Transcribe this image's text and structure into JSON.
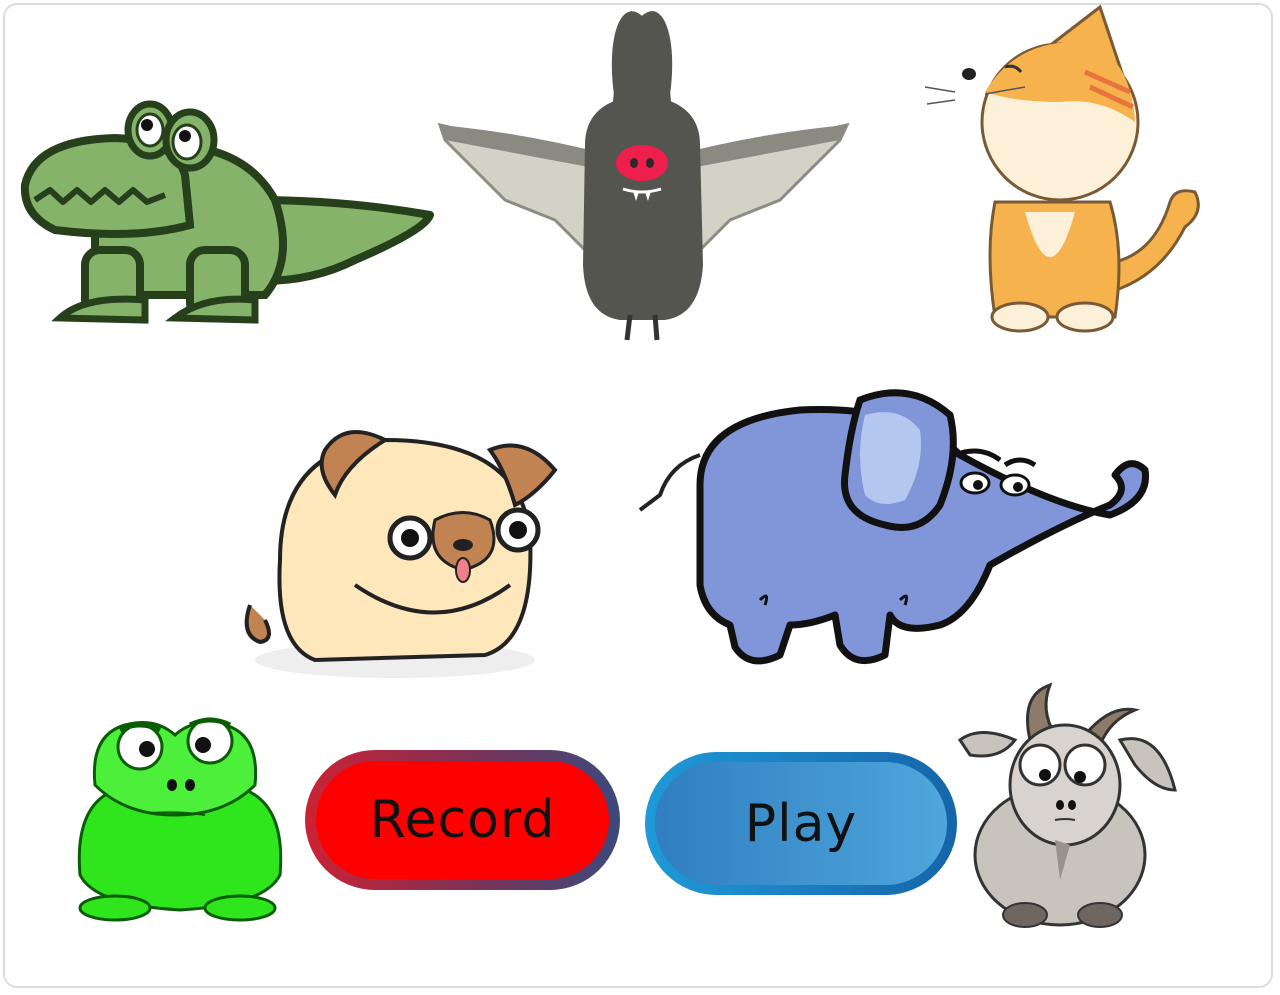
{
  "animals": [
    {
      "name": "crocodile",
      "icon": "crocodile-icon"
    },
    {
      "name": "bat",
      "icon": "bat-icon"
    },
    {
      "name": "cat",
      "icon": "cat-icon"
    },
    {
      "name": "pug",
      "icon": "pug-icon"
    },
    {
      "name": "elephant",
      "icon": "elephant-icon"
    },
    {
      "name": "frog",
      "icon": "frog-icon"
    },
    {
      "name": "goat",
      "icon": "goat-icon"
    }
  ],
  "controls": {
    "record_label": "Record",
    "play_label": "Play"
  },
  "colors": {
    "record": "#ff0000",
    "play": "#3b8fd0",
    "crocodile": "#86b36a",
    "bat": "#55554f",
    "cat": "#f6b24c",
    "pug": "#fde7bb",
    "elephant": "#8196d8",
    "frog": "#2fe61c",
    "goat": "#c9c3be"
  }
}
